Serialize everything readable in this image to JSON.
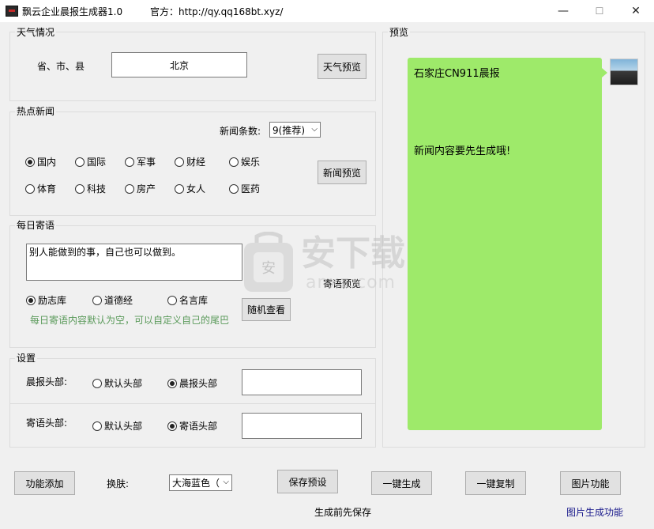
{
  "window": {
    "title": "飘云企业晨报生成器1.0",
    "site": "官方：http://qy.qq168bt.xyz/",
    "minimize": "—",
    "maximize": "☐",
    "close": "✕"
  },
  "weather": {
    "legend": "天气情况",
    "location_label": "省、市、县",
    "location_value": "北京",
    "preview_button": "天气预览"
  },
  "news": {
    "legend": "热点新闻",
    "count_label": "新闻条数:",
    "count_value": "9(推荐)",
    "preview_button": "新闻预览",
    "categories": [
      "国内",
      "国际",
      "军事",
      "财经",
      "娱乐",
      "体育",
      "科技",
      "房产",
      "女人",
      "医药"
    ],
    "selected": "国内"
  },
  "daily": {
    "legend": "每日寄语",
    "text": "别人能做到的事，自己也可以做到。",
    "preview_button": "寄语预览",
    "sources": [
      "励志库",
      "道德经",
      "名言库"
    ],
    "selected": "励志库",
    "random_button": "随机查看",
    "hint": "每日寄语内容默认为空，可以自定义自己的尾巴"
  },
  "settings": {
    "legend": "设置",
    "morning_header_label": "晨报头部:",
    "morning_default": "默认头部",
    "morning_custom": "晨报头部",
    "wish_header_label": "寄语头部:",
    "wish_default": "默认头部",
    "wish_custom": "寄语头部"
  },
  "preview": {
    "legend": "预览",
    "title": "石家庄CN911晨报",
    "body": "新闻内容要先生成哦!"
  },
  "footer": {
    "add_button": "功能添加",
    "skin_label": "换肤:",
    "skin_value": "大海蓝色（",
    "save_button": "保存预设",
    "generate_button": "一键生成",
    "copy_button": "一键复制",
    "image_button": "图片功能",
    "note": "生成前先保存",
    "image_link": "图片生成功能"
  },
  "watermark": {
    "text": "安下载",
    "sub": "anxz.com"
  },
  "colors": {
    "bubble": "#9eea6a",
    "hint": "#5a9a5a",
    "link": "#1a1a8c"
  }
}
